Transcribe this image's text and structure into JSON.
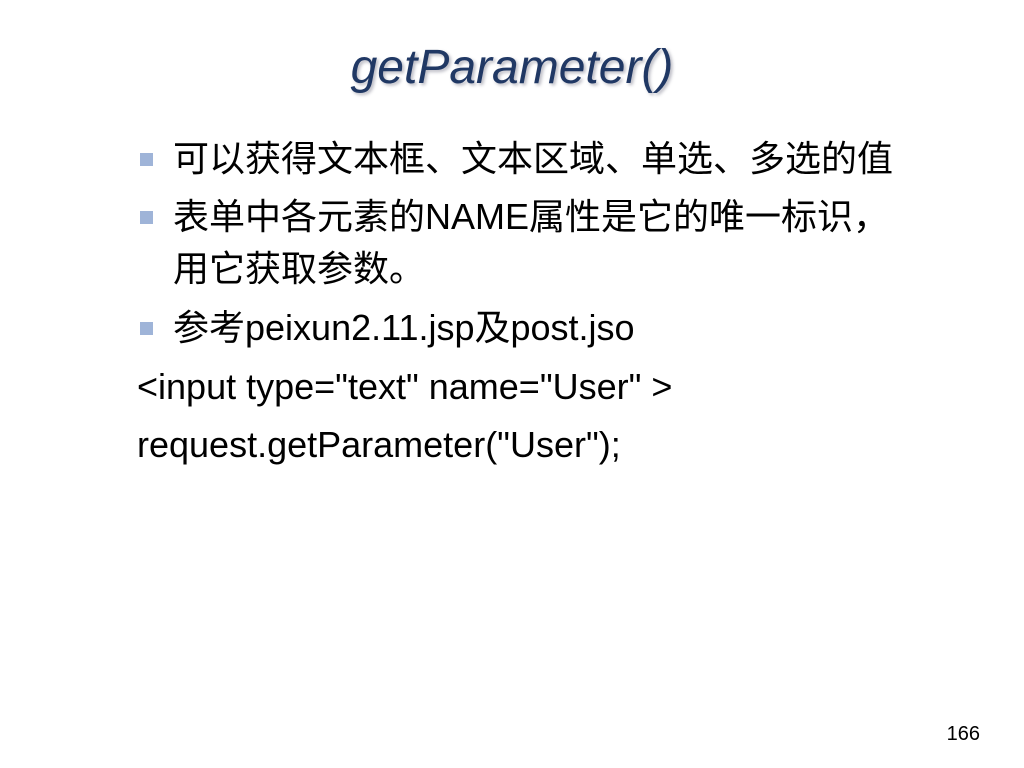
{
  "slide": {
    "title": "getParameter()",
    "bullets": [
      "可以获得文本框、文本区域、单选、多选的值",
      "表单中各元素的NAME属性是它的唯一标识，用它获取参数。",
      "参考peixun2.11.jsp及post.jso"
    ],
    "code_lines": [
      "<input type=\"text\" name=\"User\" >",
      "request.getParameter(\"User\");"
    ],
    "page_number": "166"
  }
}
